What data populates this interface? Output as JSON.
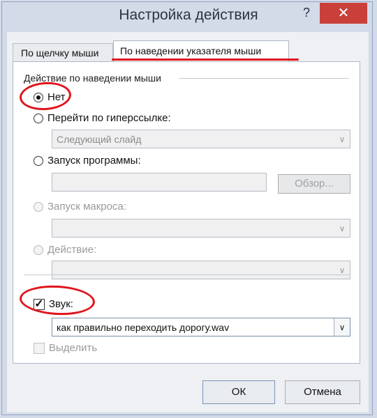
{
  "window": {
    "title": "Настройка действия",
    "help_icon": "?",
    "close_icon": "✕"
  },
  "tabs": [
    {
      "label": "По щелчку мыши",
      "active": false
    },
    {
      "label": "По наведении указателя мыши",
      "active": true
    }
  ],
  "group": {
    "title": "Действие по наведении мыши"
  },
  "options": {
    "none": {
      "label": "Нет",
      "selected": true
    },
    "hyperlink": {
      "label": "Перейти по гиперссылке:",
      "selected": false,
      "value": "Следующий слайд"
    },
    "program": {
      "label": "Запуск программы:",
      "selected": false,
      "value": "",
      "browse_label": "Обзор..."
    },
    "macro": {
      "label": "Запуск макроса:",
      "selected": false,
      "enabled": false,
      "value": ""
    },
    "action": {
      "label": "Действие:",
      "selected": false,
      "enabled": false,
      "value": ""
    }
  },
  "sound": {
    "label": "Звук:",
    "checked": true,
    "value": "как правильно переходить дорогу.wav"
  },
  "highlight": {
    "label": "Выделить",
    "checked": false,
    "enabled": false
  },
  "footer": {
    "ok_label": "ОК",
    "cancel_label": "Отмена"
  },
  "colors": {
    "annotation": "#e0141c",
    "close_button": "#c9403a"
  }
}
